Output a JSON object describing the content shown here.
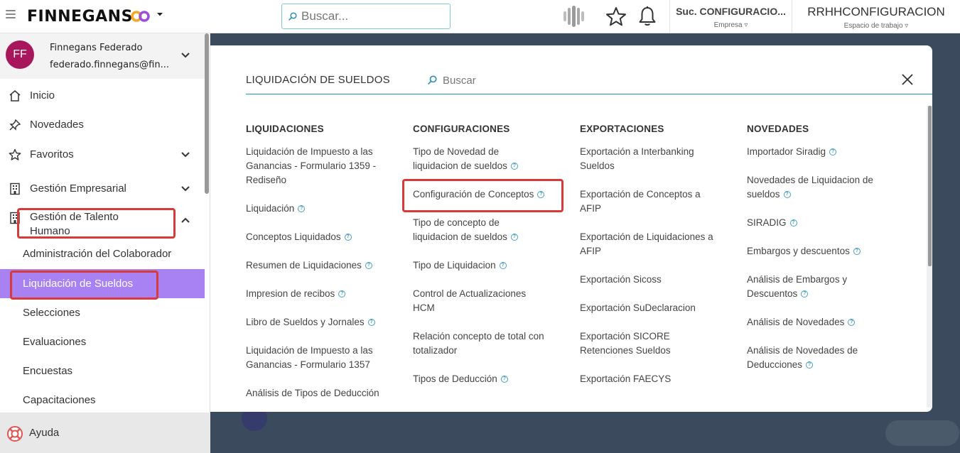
{
  "header": {
    "logo_text": "FINNEGANS",
    "search_placeholder": "Buscar...",
    "empresa_value": "Suc. CONFIGURACIO...",
    "empresa_label": "Empresa ▿",
    "espacio_value": "RRHHCONFIGURACION",
    "espacio_label": "Espacio de trabajo ▿"
  },
  "user": {
    "initials": "FF",
    "name": "Finnegans Federado",
    "email": "federado.finnegans@fin..."
  },
  "sidebar": {
    "items": [
      {
        "label": "Inicio"
      },
      {
        "label": "Novedades"
      },
      {
        "label": "Favoritos"
      },
      {
        "label": "Gestión Empresarial"
      },
      {
        "label": "Gestión de Talento Humano"
      }
    ],
    "subitems": [
      {
        "label": "Administración del Colaborador"
      },
      {
        "label": "Liquidación de Sueldos"
      },
      {
        "label": "Selecciones"
      },
      {
        "label": "Evaluaciones"
      },
      {
        "label": "Encuestas"
      },
      {
        "label": "Capacitaciones"
      }
    ],
    "help_label": "Ayuda"
  },
  "modal": {
    "title": "LIQUIDACIÓN DE SUELDOS",
    "search_placeholder": "Buscar",
    "columns": [
      {
        "title": "LIQUIDACIONES",
        "links": [
          {
            "label": "Liquidación de Impuesto a las Ganancias - Formulario 1359 - Rediseño"
          },
          {
            "label": "Liquidación",
            "help": "?"
          },
          {
            "label": "Conceptos Liquidados",
            "help": "?"
          },
          {
            "label": "Resumen de Liquidaciones",
            "help": "?"
          },
          {
            "label": "Impresion de recibos",
            "help": "?"
          },
          {
            "label": "Libro de Sueldos y Jornales",
            "help": "?"
          },
          {
            "label": "Liquidación de Impuesto a las Ganancias - Formulario 1357"
          },
          {
            "label": "Análisis de Tipos de Deducción"
          }
        ]
      },
      {
        "title": "CONFIGURACIONES",
        "links": [
          {
            "label": "Tipo de Novedad de liquidacion de sueldos",
            "help": "?"
          },
          {
            "label": "Configuración de Conceptos",
            "help": "?"
          },
          {
            "label": "Tipo de concepto de liquidacion de sueldos",
            "help": "?"
          },
          {
            "label": "Tipo de Liquidacion",
            "help": "?"
          },
          {
            "label": "Control de Actualizaciones HCM"
          },
          {
            "label": "Relación concepto de total con totalizador"
          },
          {
            "label": "Tipos de Deducción",
            "help": "?"
          }
        ]
      },
      {
        "title": "EXPORTACIONES",
        "links": [
          {
            "label": "Exportación a Interbanking Sueldos"
          },
          {
            "label": "Exportación de Conceptos a AFIP"
          },
          {
            "label": "Exportación de Liquidaciones a AFIP"
          },
          {
            "label": "Exportación Sicoss"
          },
          {
            "label": "Exportación SuDeclaracion"
          },
          {
            "label": "Exportación SICORE Retenciones Sueldos"
          },
          {
            "label": "Exportación FAECYS"
          }
        ]
      },
      {
        "title": "NOVEDADES",
        "links": [
          {
            "label": "Importador Siradig",
            "help": "?"
          },
          {
            "label": "Novedades de Liquidacion de sueldos",
            "help": "?"
          },
          {
            "label": "SIRADIG",
            "help": "?"
          },
          {
            "label": "Embargos y descuentos",
            "help": "?"
          },
          {
            "label": "Análisis de Embargos y Descuentos",
            "help": "?"
          },
          {
            "label": "Análisis de Novedades",
            "help": "?"
          },
          {
            "label": "Análisis de Novedades de Deducciones",
            "help": "?"
          }
        ]
      }
    ]
  },
  "colors": {
    "accent": "#a882f2",
    "highlight": "#d83a3a",
    "avatar": "#a8175c",
    "teal": "#1e9bb0"
  }
}
